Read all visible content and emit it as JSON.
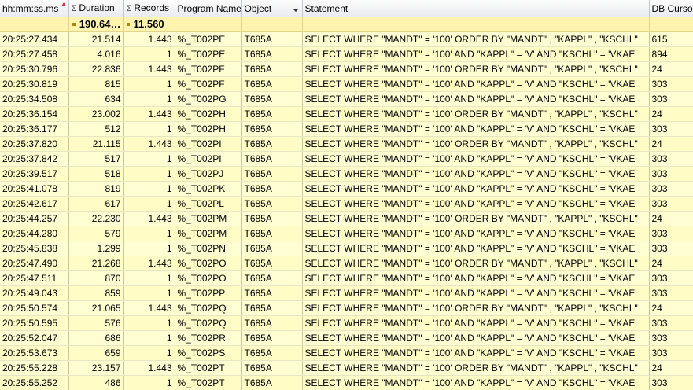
{
  "columns": [
    {
      "key": "time",
      "label": "hh:mm:ss.ms",
      "sum": false,
      "sort": "asc"
    },
    {
      "key": "duration",
      "label": "Duration",
      "sum": true
    },
    {
      "key": "records",
      "label": "Records",
      "sum": true
    },
    {
      "key": "program",
      "label": "Program Name",
      "sum": false
    },
    {
      "key": "object",
      "label": "Object",
      "sum": false,
      "filter": true
    },
    {
      "key": "statement",
      "label": "Statement",
      "sum": false
    },
    {
      "key": "cursor",
      "label": "DB Cursor",
      "sum": false
    }
  ],
  "totals": {
    "duration": "190.64…",
    "records": "11.560"
  },
  "rows": [
    {
      "time": "20:25:27.434",
      "duration": "21.514",
      "records": "1.443",
      "program": "%_T002PE",
      "object": "T685A",
      "statement": "SELECT  WHERE \"MANDT\" = '100' ORDER BY \"MANDT\" , \"KAPPL\" , \"KSCHL\"",
      "cursor": "615"
    },
    {
      "time": "20:25:27.458",
      "duration": "4.016",
      "records": "1",
      "program": "%_T002PE",
      "object": "T685A",
      "statement": "SELECT  WHERE \"MANDT\" = '100' AND \"KAPPL\" = 'V' AND \"KSCHL\" = 'VKAE'",
      "cursor": "894"
    },
    {
      "time": "20:25:30.796",
      "duration": "22.836",
      "records": "1.443",
      "program": "%_T002PF",
      "object": "T685A",
      "statement": "SELECT  WHERE \"MANDT\" = '100' ORDER BY \"MANDT\" , \"KAPPL\" , \"KSCHL\"",
      "cursor": "24"
    },
    {
      "time": "20:25:30.819",
      "duration": "815",
      "records": "1",
      "program": "%_T002PF",
      "object": "T685A",
      "statement": "SELECT  WHERE \"MANDT\" = '100' AND \"KAPPL\" = 'V' AND \"KSCHL\" = 'VKAE'",
      "cursor": "303"
    },
    {
      "time": "20:25:34.508",
      "duration": "634",
      "records": "1",
      "program": "%_T002PG",
      "object": "T685A",
      "statement": "SELECT  WHERE \"MANDT\" = '100' AND \"KAPPL\" = 'V' AND \"KSCHL\" = 'VKAE'",
      "cursor": "303"
    },
    {
      "time": "20:25:36.154",
      "duration": "23.002",
      "records": "1.443",
      "program": "%_T002PH",
      "object": "T685A",
      "statement": "SELECT  WHERE \"MANDT\" = '100' ORDER BY \"MANDT\" , \"KAPPL\" , \"KSCHL\"",
      "cursor": "24"
    },
    {
      "time": "20:25:36.177",
      "duration": "512",
      "records": "1",
      "program": "%_T002PH",
      "object": "T685A",
      "statement": "SELECT  WHERE \"MANDT\" = '100' AND \"KAPPL\" = 'V' AND \"KSCHL\" = 'VKAE'",
      "cursor": "303"
    },
    {
      "time": "20:25:37.820",
      "duration": "21.115",
      "records": "1.443",
      "program": "%_T002PI",
      "object": "T685A",
      "statement": "SELECT  WHERE \"MANDT\" = '100' ORDER BY \"MANDT\" , \"KAPPL\" , \"KSCHL\"",
      "cursor": "24"
    },
    {
      "time": "20:25:37.842",
      "duration": "517",
      "records": "1",
      "program": "%_T002PI",
      "object": "T685A",
      "statement": "SELECT  WHERE \"MANDT\" = '100' AND \"KAPPL\" = 'V' AND \"KSCHL\" = 'VKAE'",
      "cursor": "303"
    },
    {
      "time": "20:25:39.517",
      "duration": "518",
      "records": "1",
      "program": "%_T002PJ",
      "object": "T685A",
      "statement": "SELECT  WHERE \"MANDT\" = '100' AND \"KAPPL\" = 'V' AND \"KSCHL\" = 'VKAE'",
      "cursor": "303"
    },
    {
      "time": "20:25:41.078",
      "duration": "819",
      "records": "1",
      "program": "%_T002PK",
      "object": "T685A",
      "statement": "SELECT  WHERE \"MANDT\" = '100' AND \"KAPPL\" = 'V' AND \"KSCHL\" = 'VKAE'",
      "cursor": "303"
    },
    {
      "time": "20:25:42.617",
      "duration": "617",
      "records": "1",
      "program": "%_T002PL",
      "object": "T685A",
      "statement": "SELECT  WHERE \"MANDT\" = '100' AND \"KAPPL\" = 'V' AND \"KSCHL\" = 'VKAE'",
      "cursor": "303"
    },
    {
      "time": "20:25:44.257",
      "duration": "22.230",
      "records": "1.443",
      "program": "%_T002PM",
      "object": "T685A",
      "statement": "SELECT  WHERE \"MANDT\" = '100' ORDER BY \"MANDT\" , \"KAPPL\" , \"KSCHL\"",
      "cursor": "24"
    },
    {
      "time": "20:25:44.280",
      "duration": "579",
      "records": "1",
      "program": "%_T002PM",
      "object": "T685A",
      "statement": "SELECT  WHERE \"MANDT\" = '100' AND \"KAPPL\" = 'V' AND \"KSCHL\" = 'VKAE'",
      "cursor": "303"
    },
    {
      "time": "20:25:45.838",
      "duration": "1.299",
      "records": "1",
      "program": "%_T002PN",
      "object": "T685A",
      "statement": "SELECT  WHERE \"MANDT\" = '100' AND \"KAPPL\" = 'V' AND \"KSCHL\" = 'VKAE'",
      "cursor": "303"
    },
    {
      "time": "20:25:47.490",
      "duration": "21.268",
      "records": "1.443",
      "program": "%_T002PO",
      "object": "T685A",
      "statement": "SELECT  WHERE \"MANDT\" = '100' ORDER BY \"MANDT\" , \"KAPPL\" , \"KSCHL\"",
      "cursor": "24"
    },
    {
      "time": "20:25:47.511",
      "duration": "870",
      "records": "1",
      "program": "%_T002PO",
      "object": "T685A",
      "statement": "SELECT  WHERE \"MANDT\" = '100' AND \"KAPPL\" = 'V' AND \"KSCHL\" = 'VKAE'",
      "cursor": "303"
    },
    {
      "time": "20:25:49.043",
      "duration": "859",
      "records": "1",
      "program": "%_T002PP",
      "object": "T685A",
      "statement": "SELECT  WHERE \"MANDT\" = '100' AND \"KAPPL\" = 'V' AND \"KSCHL\" = 'VKAE'",
      "cursor": "303"
    },
    {
      "time": "20:25:50.574",
      "duration": "21.065",
      "records": "1.443",
      "program": "%_T002PQ",
      "object": "T685A",
      "statement": "SELECT  WHERE \"MANDT\" = '100' ORDER BY \"MANDT\" , \"KAPPL\" , \"KSCHL\"",
      "cursor": "24"
    },
    {
      "time": "20:25:50.595",
      "duration": "576",
      "records": "1",
      "program": "%_T002PQ",
      "object": "T685A",
      "statement": "SELECT  WHERE \"MANDT\" = '100' AND \"KAPPL\" = 'V' AND \"KSCHL\" = 'VKAE'",
      "cursor": "303"
    },
    {
      "time": "20:25:52.047",
      "duration": "686",
      "records": "1",
      "program": "%_T002PR",
      "object": "T685A",
      "statement": "SELECT  WHERE \"MANDT\" = '100' AND \"KAPPL\" = 'V' AND \"KSCHL\" = 'VKAE'",
      "cursor": "303"
    },
    {
      "time": "20:25:53.673",
      "duration": "659",
      "records": "1",
      "program": "%_T002PS",
      "object": "T685A",
      "statement": "SELECT  WHERE \"MANDT\" = '100' AND \"KAPPL\" = 'V' AND \"KSCHL\" = 'VKAE'",
      "cursor": "303"
    },
    {
      "time": "20:25:55.228",
      "duration": "23.157",
      "records": "1.443",
      "program": "%_T002PT",
      "object": "T685A",
      "statement": "SELECT  WHERE \"MANDT\" = '100' ORDER BY \"MANDT\" , \"KAPPL\" , \"KSCHL\"",
      "cursor": "24"
    },
    {
      "time": "20:25:55.252",
      "duration": "486",
      "records": "1",
      "program": "%_T002PT",
      "object": "T685A",
      "statement": "SELECT  WHERE \"MANDT\" = '100' AND \"KAPPL\" = 'V' AND \"KSCHL\" = 'VKAE'",
      "cursor": "303"
    }
  ]
}
